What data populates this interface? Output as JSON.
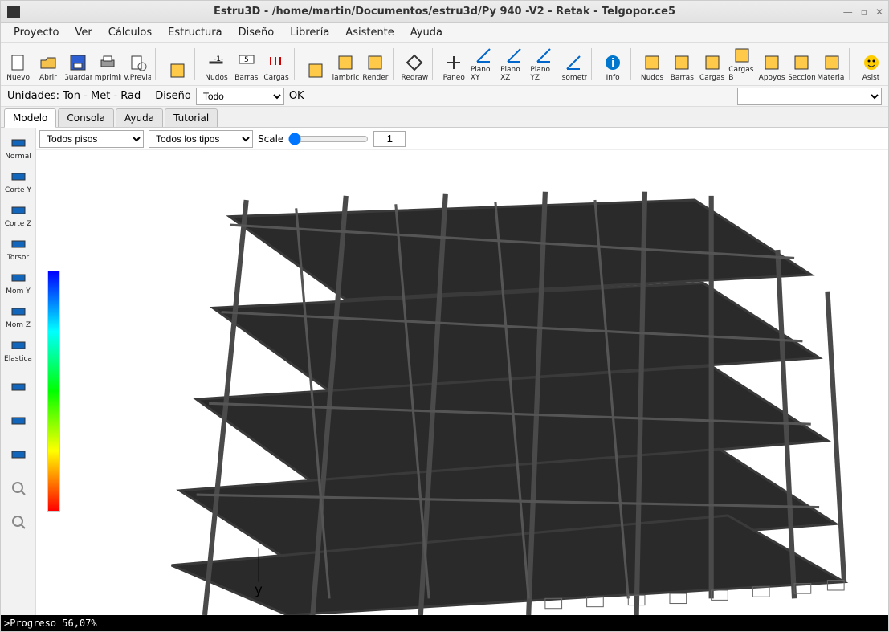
{
  "title": "Estru3D - /home/martin/Documentos/estru3d/Py 940 -V2 - Retak - Telgopor.ce5",
  "menu": [
    "Proyecto",
    "Ver",
    "Cálculos",
    "Estructura",
    "Diseño",
    "Librería",
    "Asistente",
    "Ayuda"
  ],
  "toolbar": [
    {
      "id": "nuevo",
      "label": "Nuevo"
    },
    {
      "id": "abrir",
      "label": "Abrir"
    },
    {
      "id": "guardar",
      "label": "Guardar"
    },
    {
      "id": "imprimir",
      "label": "Imprimir"
    },
    {
      "id": "vprevia",
      "label": "V.Previa"
    },
    {
      "id": "sep"
    },
    {
      "id": "tool-sup",
      "label": ""
    },
    {
      "id": "sep"
    },
    {
      "id": "nudos",
      "label": "Nudos"
    },
    {
      "id": "barras",
      "label": "Barras"
    },
    {
      "id": "cargas",
      "label": "Cargas"
    },
    {
      "id": "sep"
    },
    {
      "id": "cargas2",
      "label": ""
    },
    {
      "id": "alambrico",
      "label": "Alambrico"
    },
    {
      "id": "render",
      "label": "Render"
    },
    {
      "id": "sep"
    },
    {
      "id": "redraw",
      "label": "Redraw"
    },
    {
      "id": "sep"
    },
    {
      "id": "paneo",
      "label": "Paneo"
    },
    {
      "id": "planoxy",
      "label": "Plano XY"
    },
    {
      "id": "planoxz",
      "label": "Plano XZ"
    },
    {
      "id": "planoyz",
      "label": "Plano YZ"
    },
    {
      "id": "isometr",
      "label": "Isometr"
    },
    {
      "id": "sep"
    },
    {
      "id": "info",
      "label": "Info"
    },
    {
      "id": "sep"
    },
    {
      "id": "nudos2",
      "label": "Nudos"
    },
    {
      "id": "barras2",
      "label": "Barras"
    },
    {
      "id": "cargas3",
      "label": "Cargas"
    },
    {
      "id": "cargas-b",
      "label": "Cargas B"
    },
    {
      "id": "apoyos",
      "label": "Apoyos"
    },
    {
      "id": "seccion",
      "label": "Seccion"
    },
    {
      "id": "material",
      "label": "Material"
    },
    {
      "id": "sep"
    },
    {
      "id": "asist",
      "label": "Asist"
    }
  ],
  "settings": {
    "unidades_label": "Unidades: Ton - Met - Rad",
    "diseno_label": "Diseño",
    "diseno_value": "Todo",
    "ok": "OK"
  },
  "tabs": [
    {
      "id": "modelo",
      "label": "Modelo",
      "active": true
    },
    {
      "id": "consola",
      "label": "Consola",
      "active": false
    },
    {
      "id": "ayuda",
      "label": "Ayuda",
      "active": false
    },
    {
      "id": "tutorial",
      "label": "Tutorial",
      "active": false
    }
  ],
  "side_tools": [
    {
      "id": "normal",
      "label": "Normal"
    },
    {
      "id": "cortey",
      "label": "Corte Y"
    },
    {
      "id": "cortez",
      "label": "Corte Z"
    },
    {
      "id": "torsor",
      "label": "Torsor"
    },
    {
      "id": "momy",
      "label": "Mom Y"
    },
    {
      "id": "momz",
      "label": "Mom Z"
    },
    {
      "id": "elastica",
      "label": "Elastica"
    },
    {
      "id": "na",
      "label": ""
    },
    {
      "id": "nb",
      "label": ""
    },
    {
      "id": "nc",
      "label": ""
    },
    {
      "id": "zoomin",
      "label": ""
    },
    {
      "id": "zoomout",
      "label": ""
    }
  ],
  "filters": {
    "pisos": "Todos pisos",
    "tipos": "Todos los tipos",
    "scale_label": "Scale",
    "scale_value": "1"
  },
  "axis_label": "y",
  "status": ">Progreso 56,07%"
}
